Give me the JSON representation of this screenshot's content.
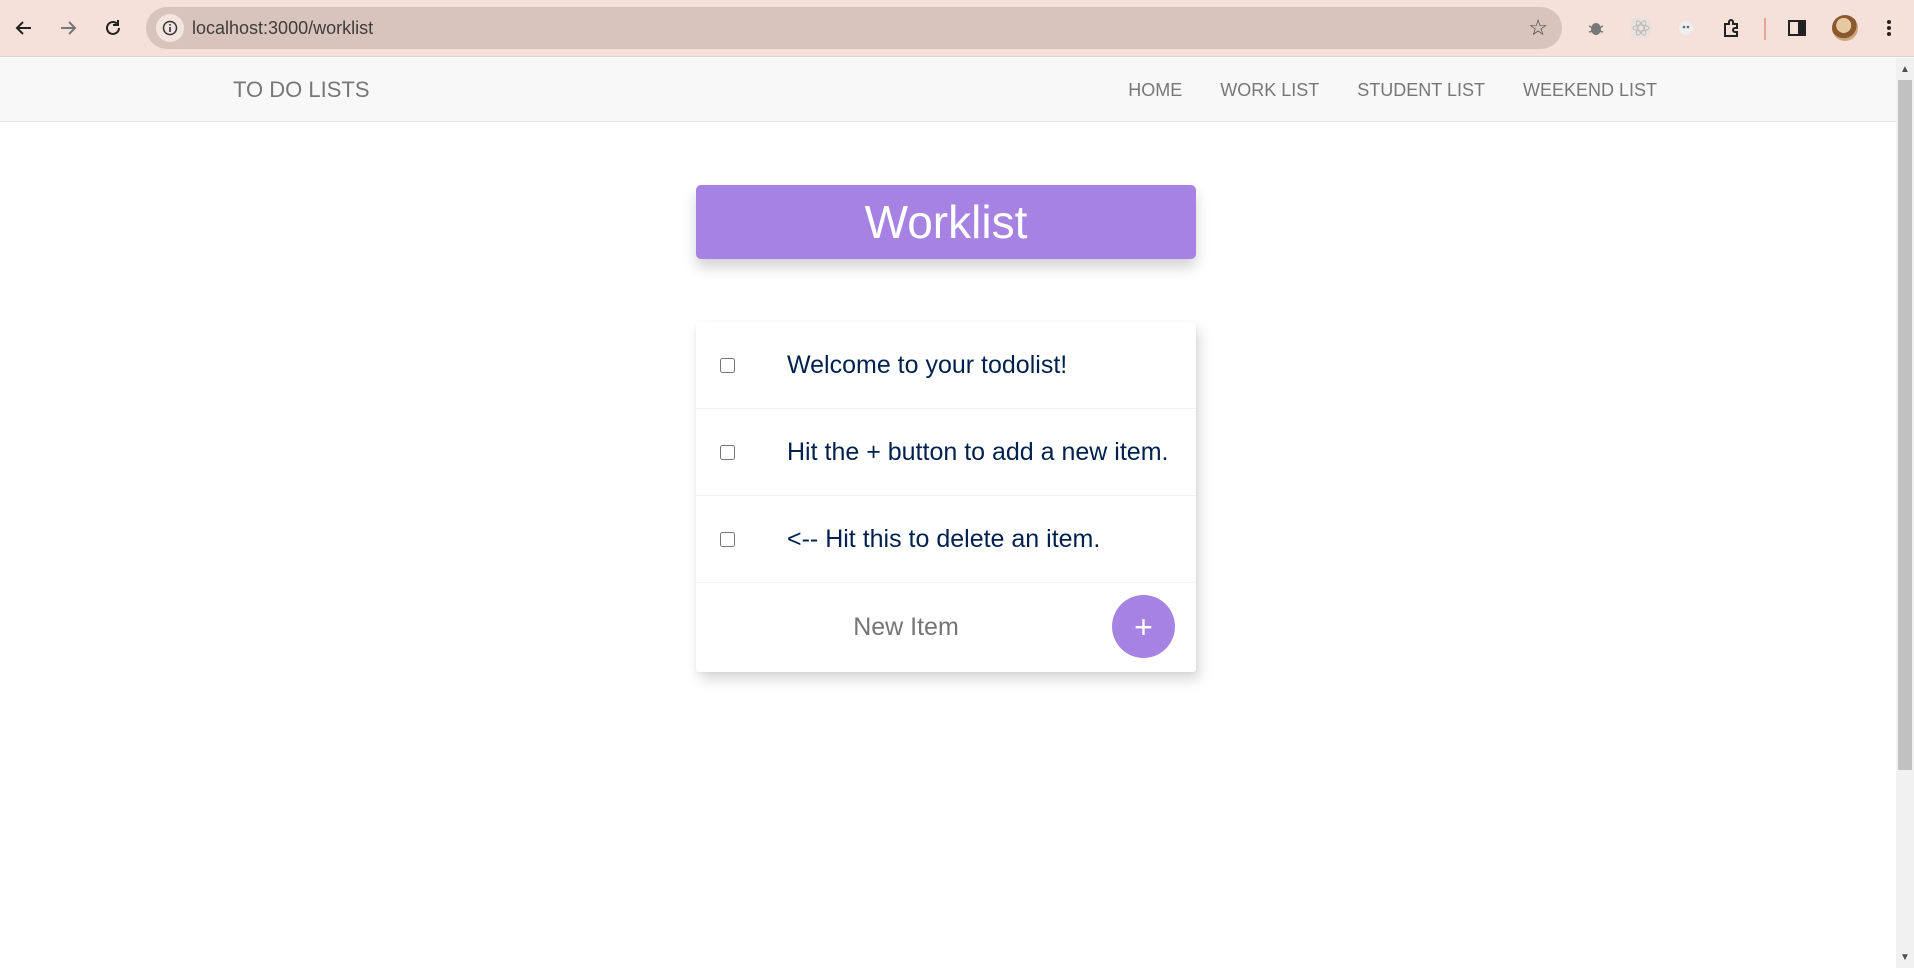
{
  "browser": {
    "url": "localhost:3000/worklist"
  },
  "navbar": {
    "brand": "TO DO LISTS",
    "links": [
      "HOME",
      "WORK LIST",
      "STUDENT LIST",
      "WEEKEND LIST"
    ]
  },
  "page": {
    "heading": "Worklist",
    "items": [
      {
        "text": "Welcome to your todolist!",
        "checked": false
      },
      {
        "text": "Hit the + button to add a new item.",
        "checked": false
      },
      {
        "text": "<-- Hit this to delete an item.",
        "checked": false
      }
    ],
    "new_item_placeholder": "New Item",
    "add_button_label": "+"
  },
  "colors": {
    "accent": "#a683e3",
    "item_text": "#00214d",
    "chrome_bg": "#f6e0da"
  }
}
